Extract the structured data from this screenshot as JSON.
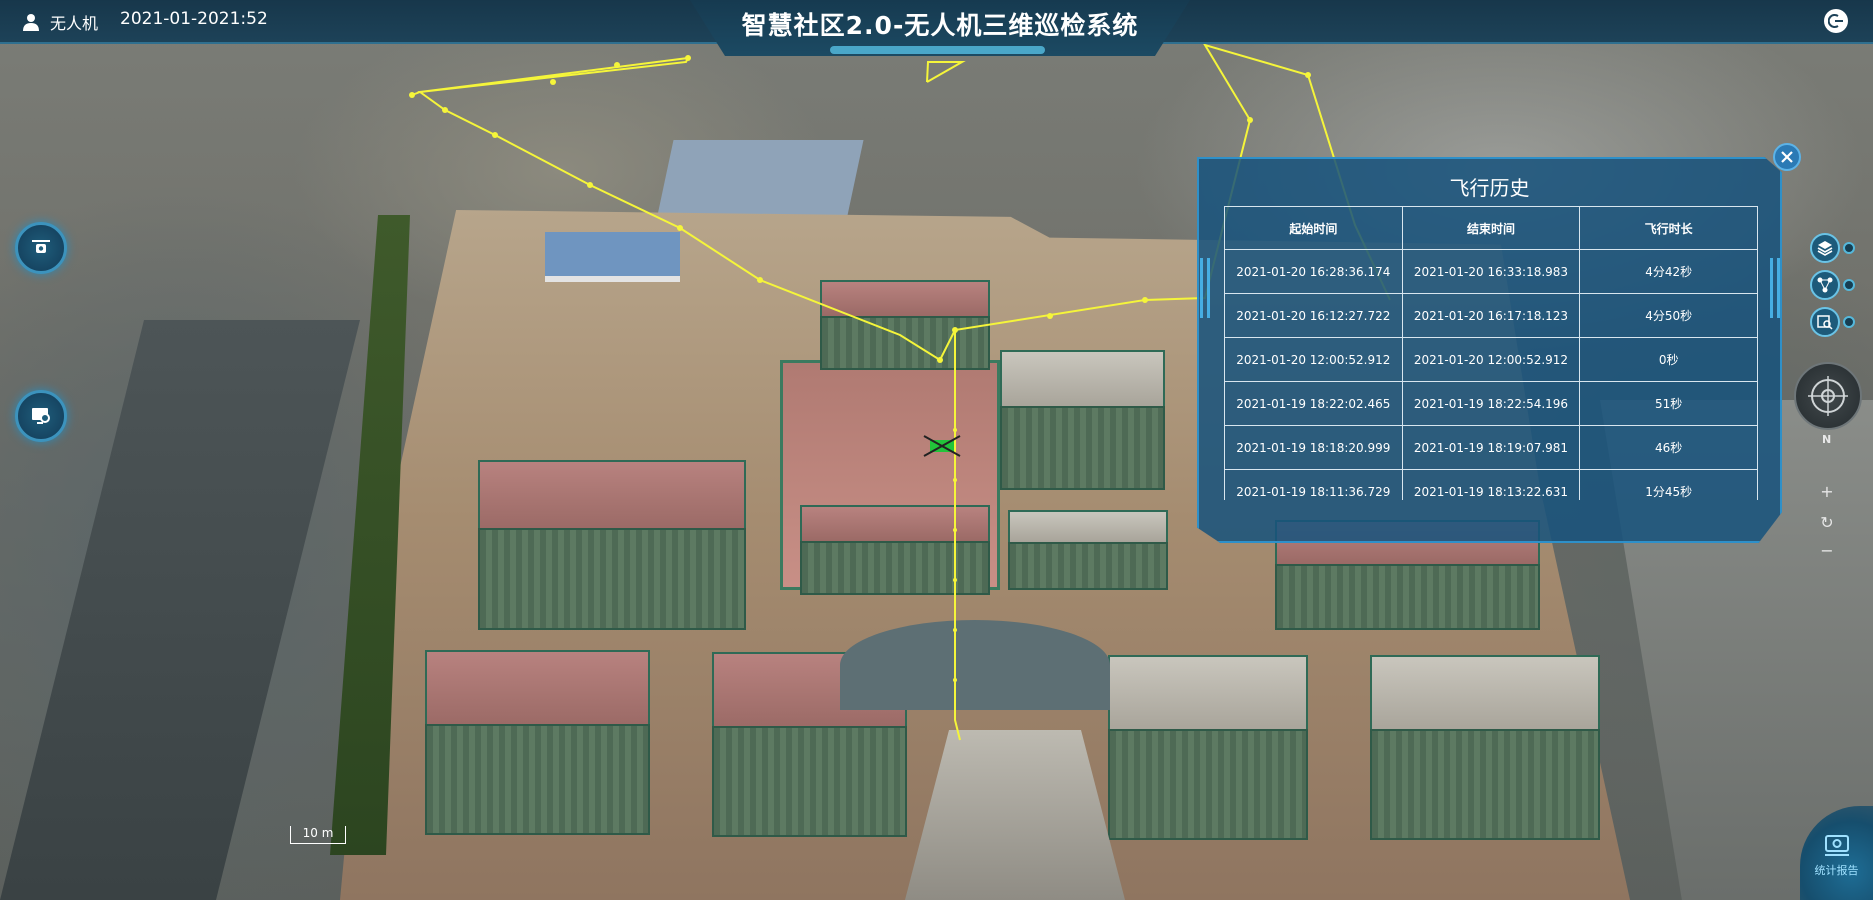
{
  "header": {
    "title": "智慧社区2.0-无人机三维巡检系统",
    "user_label": "无人机",
    "datetime": "2021-01-2021:52"
  },
  "icons": {
    "user": "user-icon",
    "logout": "logout-icon",
    "drone_camera": "drone-camera-icon",
    "monitor": "monitor-icon",
    "layers": "layers-icon",
    "network": "network-icon",
    "search_map": "search-map-icon",
    "compass": "compass-icon",
    "close": "close-icon",
    "report": "report-icon"
  },
  "map_controls": {
    "compass_label": "N",
    "zoom_in": "+",
    "reset": "↻",
    "zoom_out": "−",
    "scale": "10 m"
  },
  "report": {
    "label": "统计报告"
  },
  "flight_history": {
    "title": "飞行历史",
    "columns": [
      "起始时间",
      "结束时间",
      "飞行时长"
    ],
    "rows": [
      [
        "2021-01-20 16:28:36.174",
        "2021-01-20 16:33:18.983",
        "4分42秒"
      ],
      [
        "2021-01-20 16:12:27.722",
        "2021-01-20 16:17:18.123",
        "4分50秒"
      ],
      [
        "2021-01-20 12:00:52.912",
        "2021-01-20 12:00:52.912",
        "0秒"
      ],
      [
        "2021-01-19 18:22:02.465",
        "2021-01-19 18:22:54.196",
        "51秒"
      ],
      [
        "2021-01-19 18:18:20.999",
        "2021-01-19 18:19:07.981",
        "46秒"
      ],
      [
        "2021-01-19 18:11:36.729",
        "2021-01-19 18:13:22.631",
        "1分45秒"
      ]
    ]
  },
  "colors": {
    "flight_path": "#f5f53a",
    "header_bg": "#17374b",
    "panel_bg": "#16527d",
    "accent": "#3c93bd"
  }
}
